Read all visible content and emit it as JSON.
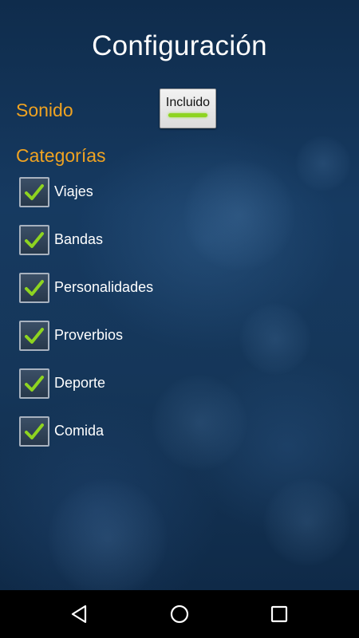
{
  "title": "Configuración",
  "sound": {
    "label": "Sonido",
    "toggle_label": "Incluido",
    "toggle_on": true
  },
  "categories": {
    "label": "Categorías",
    "items": [
      {
        "label": "Viajes",
        "checked": true
      },
      {
        "label": "Bandas",
        "checked": true
      },
      {
        "label": "Personalidades",
        "checked": true
      },
      {
        "label": "Proverbios",
        "checked": true
      },
      {
        "label": "Deporte",
        "checked": true
      },
      {
        "label": "Comida",
        "checked": true
      }
    ]
  },
  "colors": {
    "accent": "#f0a321",
    "check": "#8ed420",
    "background": "#163a61"
  },
  "navbar": {
    "back_icon": "back-triangle-icon",
    "home_icon": "home-circle-icon",
    "recents_icon": "recents-square-icon"
  }
}
